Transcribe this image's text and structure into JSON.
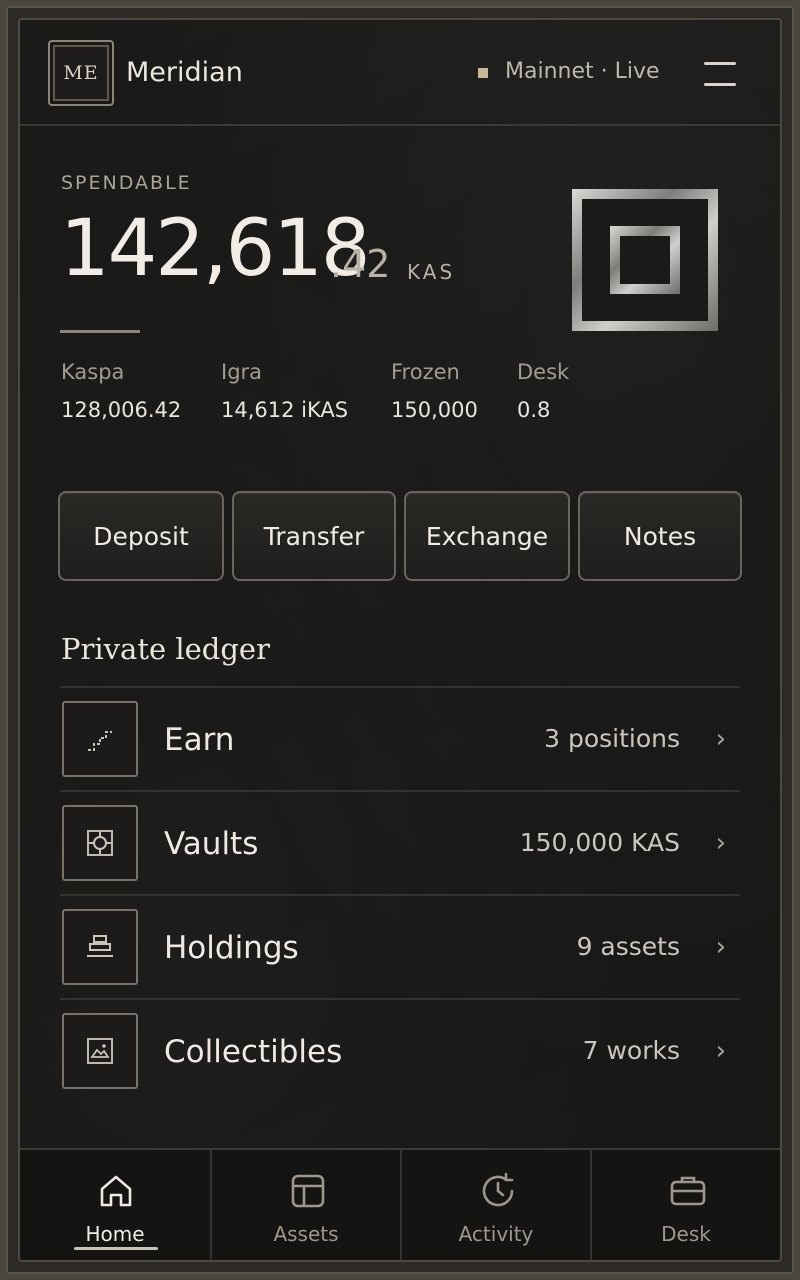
{
  "header": {
    "logo_text": "ME",
    "app_name": "Meridian",
    "network_status": "Mainnet · Live"
  },
  "balance": {
    "label": "SPENDABLE",
    "whole": "142,618",
    "fraction": ".42",
    "unit": "KAS"
  },
  "stats": [
    {
      "label": "Kaspa",
      "value": "128,006.42"
    },
    {
      "label": "Igra",
      "value": "14,612 iKAS"
    },
    {
      "label": "Frozen",
      "value": "150,000"
    },
    {
      "label": "Desk",
      "value": "0.8"
    }
  ],
  "actions": {
    "deposit": "Deposit",
    "transfer": "Transfer",
    "exchange": "Exchange",
    "notes": "Notes"
  },
  "ledger": {
    "title": "Private ledger",
    "rows": [
      {
        "name": "Earn",
        "meta": "3 positions",
        "icon": "stairs-icon"
      },
      {
        "name": "Vaults",
        "meta": "150,000 KAS",
        "icon": "target-icon"
      },
      {
        "name": "Holdings",
        "meta": "9 assets",
        "icon": "stack-icon"
      },
      {
        "name": "Collectibles",
        "meta": "7 works",
        "icon": "image-icon"
      }
    ]
  },
  "nav": {
    "items": [
      {
        "label": "Home",
        "icon": "home-icon",
        "active": true
      },
      {
        "label": "Assets",
        "icon": "layout-icon",
        "active": false
      },
      {
        "label": "Activity",
        "icon": "history-icon",
        "active": false
      },
      {
        "label": "Desk",
        "icon": "briefcase-icon",
        "active": false
      }
    ]
  },
  "colors": {
    "background": "#161615",
    "accent_dot": "#c9b79a",
    "text_primary": "#f1ede6",
    "border": "#6a655c"
  }
}
